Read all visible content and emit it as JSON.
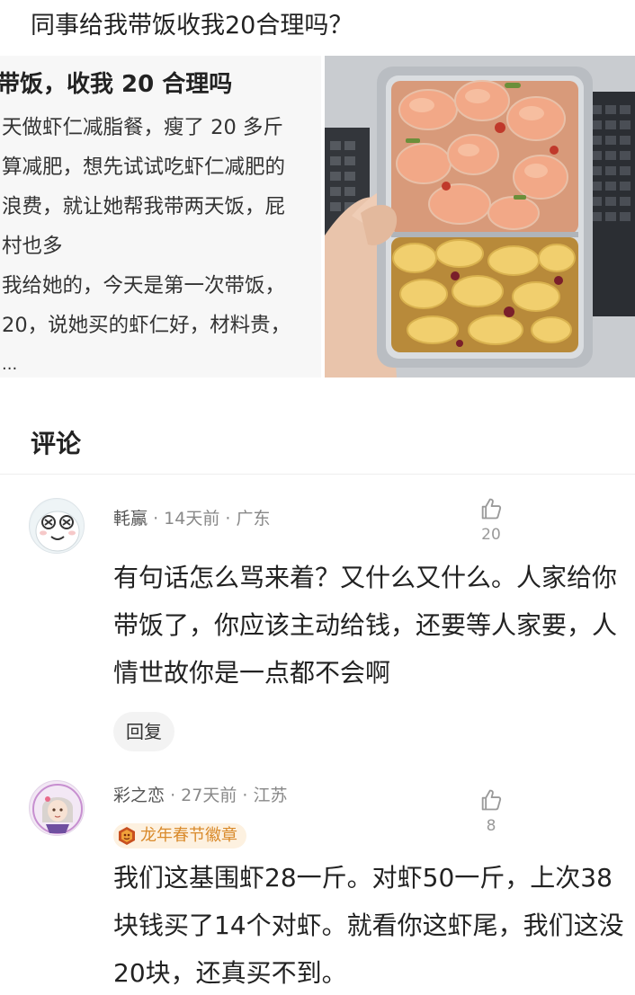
{
  "post": {
    "title": "同事给我带饭收我20合理吗？"
  },
  "cropped_text": {
    "heading": "带饭，收我 20 合理吗",
    "lines": [
      "天做虾仁减脂餐，瘦了 20 多斤",
      "算减肥，想先试试吃虾仁减肥的",
      "浪费，就让她帮我带两天饭，屁",
      "村也多",
      "我给她的，今天是第一次带饭，",
      "20，说她买的虾仁好，材料贵，",
      "..."
    ]
  },
  "comments_section": {
    "title": "评论"
  },
  "comments": [
    {
      "username": "軞鸁",
      "time": "14天前",
      "location": "广东",
      "likes": "20",
      "text": "有句话怎么骂来着？又什么又什么。人家给你带饭了，你应该主动给钱，还要等人家要，人情世故你是一点都不会啊",
      "reply_label": "回复"
    },
    {
      "username": "彩之恋",
      "time": "27天前",
      "location": "江苏",
      "likes": "8",
      "badge": "龙年春节徽章",
      "text": "我们这基围虾28一斤。对虾50一斤，上次38块钱买了14个对虾。就看你这虾尾，我们这没20块，还真买不到。"
    }
  ],
  "colors": {
    "meta_gray": "#888888",
    "badge_bg": "#fdf1e0",
    "badge_text": "#d98a2b",
    "reply_bg": "#f3f3f3"
  },
  "icons": [
    "thumbs-up-icon",
    "dragon-badge-icon"
  ]
}
